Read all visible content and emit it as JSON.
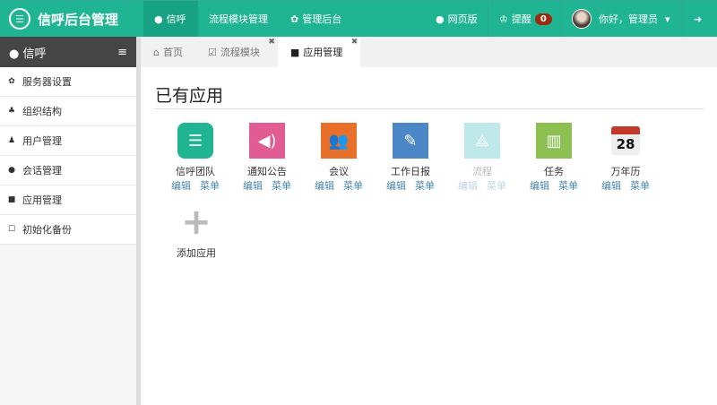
{
  "header": {
    "brand": "信呼后台管理",
    "nav": [
      {
        "label": "信呼",
        "icon": "comment-icon"
      },
      {
        "label": "流程模块管理"
      },
      {
        "label": "管理后台",
        "icon": "gear-icon"
      }
    ],
    "web": "网页版",
    "remind": "提醒",
    "remind_count": "0",
    "greeting": "你好，管理员"
  },
  "sidebar": {
    "title": "信呼",
    "items": [
      {
        "label": "服务器设置",
        "icon": "gear-icon"
      },
      {
        "label": "组织结构",
        "icon": "sitemap-icon"
      },
      {
        "label": "用户管理",
        "icon": "user-icon"
      },
      {
        "label": "会话管理",
        "icon": "comments-icon"
      },
      {
        "label": "应用管理",
        "icon": "grid-icon"
      },
      {
        "label": "初始化备份",
        "icon": "bookmark-icon"
      }
    ]
  },
  "tabs": [
    {
      "label": "首页",
      "icon": "home-icon"
    },
    {
      "label": "流程模块",
      "icon": "check-square-icon"
    },
    {
      "label": "应用管理",
      "icon": "grid-icon"
    }
  ],
  "main": {
    "title": "已有应用",
    "edit": "编辑",
    "menu": "菜单",
    "apps": [
      {
        "name": "信呼团队",
        "color": "#1fb593"
      },
      {
        "name": "通知公告",
        "color": "#e05c93"
      },
      {
        "name": "会议",
        "color": "#e8702a"
      },
      {
        "name": "工作日报",
        "color": "#4b86c6"
      },
      {
        "name": "流程",
        "color": "#bfe8ea"
      },
      {
        "name": "任务",
        "color": "#8cc152"
      },
      {
        "name": "万年历",
        "color": "#ffffff"
      }
    ],
    "add": "添加应用",
    "calendar_day": "28"
  }
}
